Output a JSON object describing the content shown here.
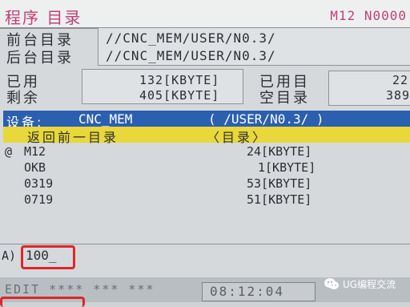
{
  "header": {
    "title": "程序 目录",
    "program_number": "M12 N0000"
  },
  "paths": {
    "foreground_label": "前台目录",
    "foreground_path": "//CNC_MEM/USER/N0.3/",
    "background_label": "后台目录",
    "background_path": "//CNC_MEM/USER/N0.3/"
  },
  "memory": {
    "used_label": "已用",
    "used_value": "132[KBYTE]",
    "remaining_label": "剩余",
    "remaining_value": "405[KBYTE]",
    "used_dirs_label": "已用目",
    "used_dirs_value": "22",
    "free_dirs_label": "空目录",
    "free_dirs_value": "389"
  },
  "device_bar": {
    "label": "设备:",
    "device": "CNC_MEM",
    "path": "( /USER/N0.3/ )"
  },
  "back_row": {
    "label": "返回前一目录",
    "type": "〈目录〉"
  },
  "files": [
    {
      "marker": "@",
      "name": "M12",
      "size": "24[KBYTE]"
    },
    {
      "marker": "",
      "name": "OKB",
      "size": "1[KBYTE]"
    },
    {
      "marker": "",
      "name": "0319",
      "size": "53[KBYTE]"
    },
    {
      "marker": "",
      "name": "0719",
      "size": "51[KBYTE]"
    }
  ],
  "input": {
    "prompt": "A)",
    "value": "100_"
  },
  "status": {
    "mode": "EDIT **** *** ***",
    "time": "08:12:04"
  },
  "watermark": {
    "text": "UG编程交流",
    "icon": "wechat-icon"
  },
  "colors": {
    "title": "#c0407a",
    "selection_blue": "#2b5fb0",
    "selection_yellow": "#e8d83a",
    "annotation_red": "#e0262b"
  }
}
